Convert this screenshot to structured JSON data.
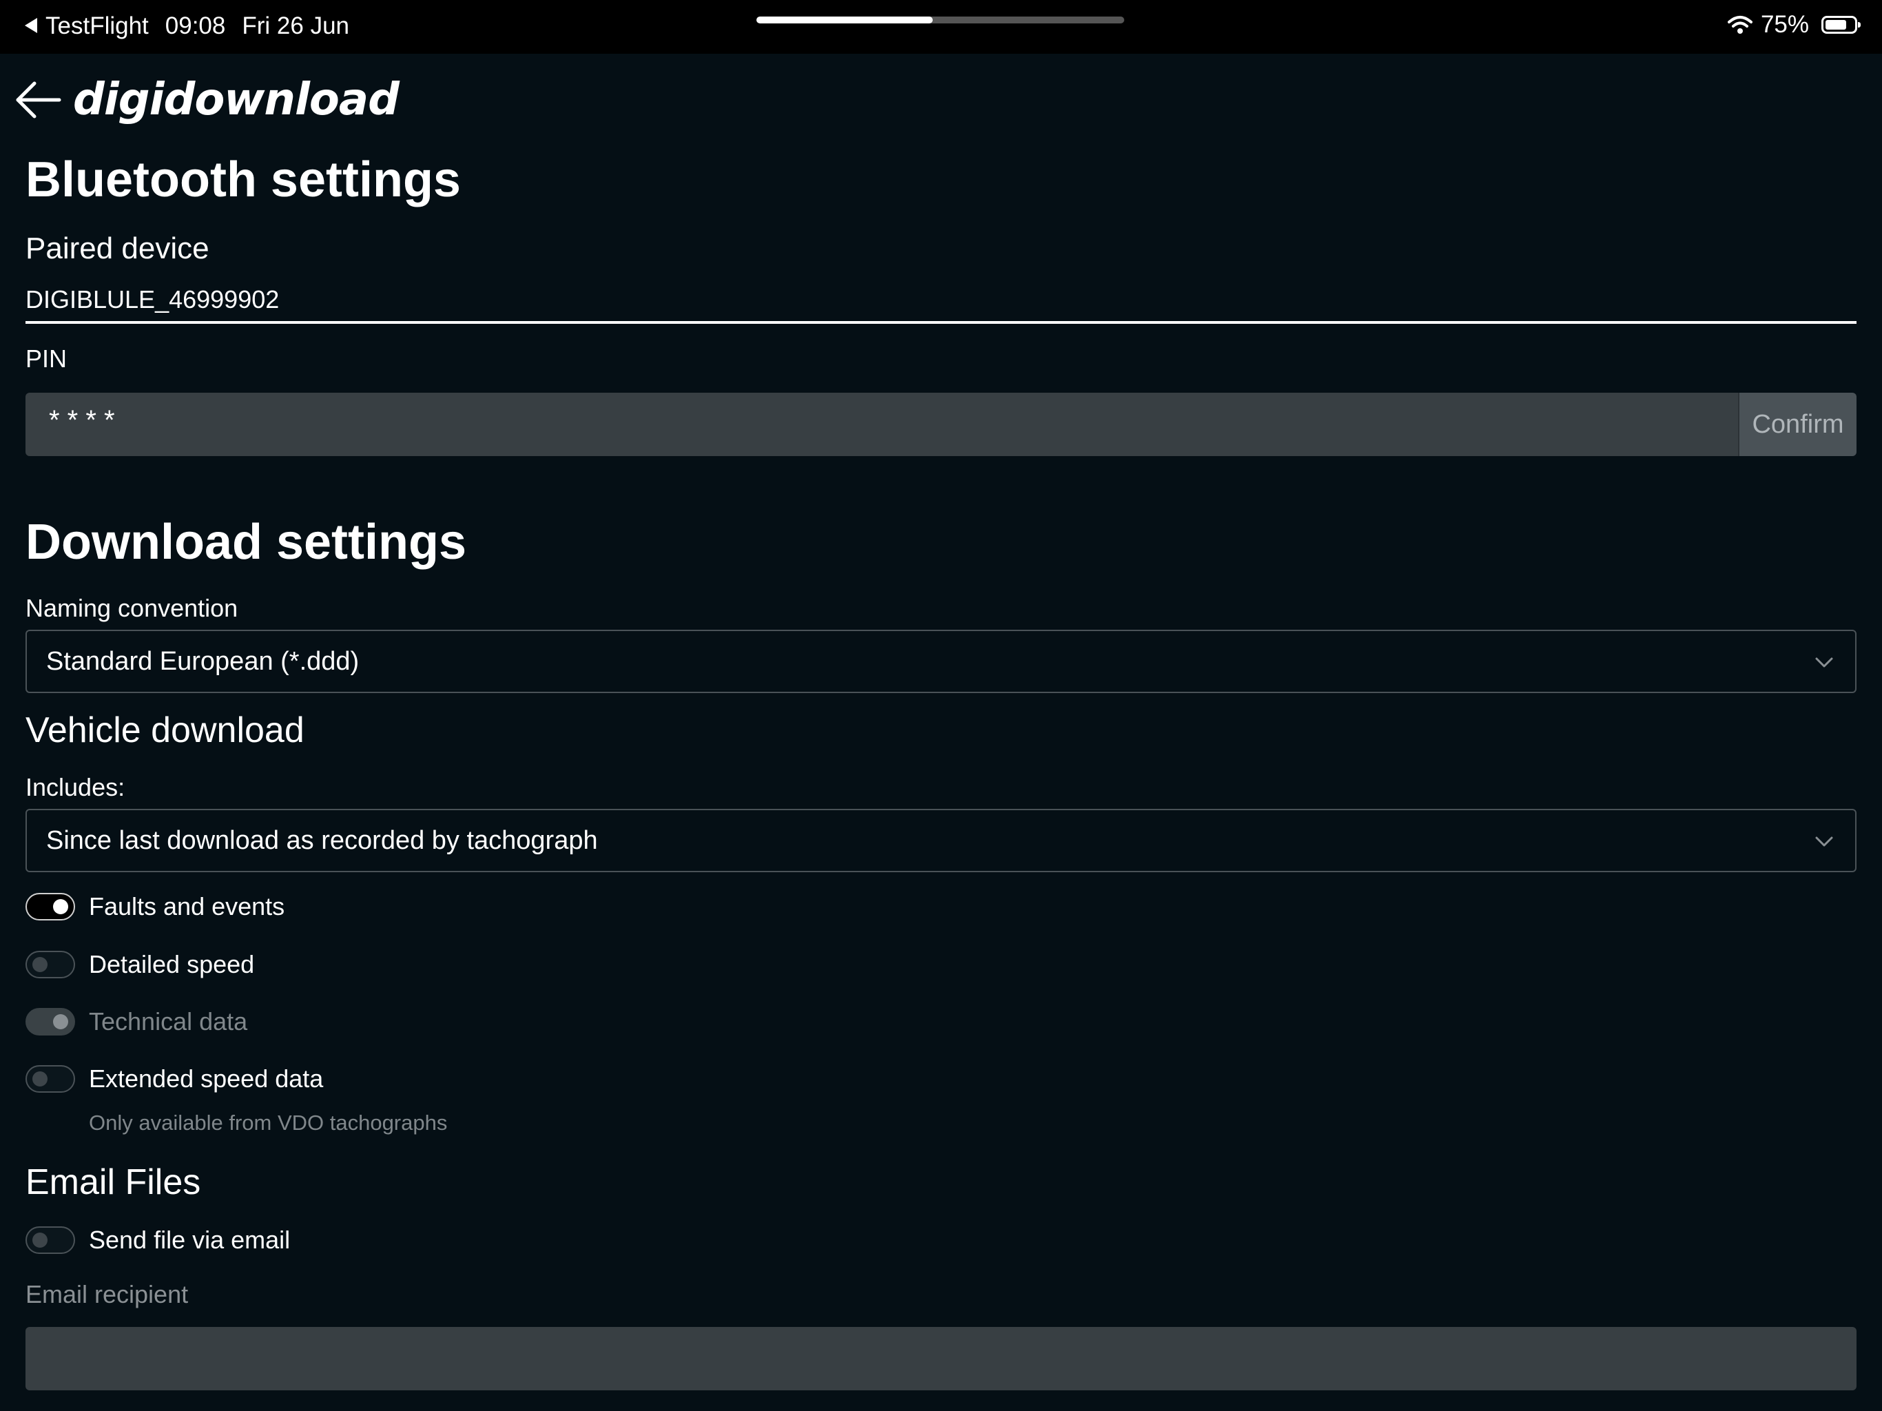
{
  "status_bar": {
    "back_app": "TestFlight",
    "time": "09:08",
    "date": "Fri 26 Jun",
    "battery": "75%",
    "battery_level": 0.75,
    "multitask_progress": 0.48
  },
  "header": {
    "back_icon": "arrow-left-icon",
    "logo": "digidownload"
  },
  "bluetooth": {
    "title": "Bluetooth settings",
    "paired_label": "Paired device",
    "paired_value": "DIGIBLULE_46999902",
    "pin_label": "PIN",
    "pin_value": "* * * *",
    "confirm_label": "Confirm"
  },
  "download": {
    "title": "Download settings",
    "naming_label": "Naming convention",
    "naming_value": "Standard European (*.ddd)"
  },
  "vehicle": {
    "title": "Vehicle download",
    "includes_label": "Includes:",
    "includes_value": "Since last download as recorded by tachograph",
    "toggles": [
      {
        "label": "Faults and events",
        "state": "on"
      },
      {
        "label": "Detailed speed",
        "state": "off"
      },
      {
        "label": "Technical data",
        "state": "disabled-on"
      },
      {
        "label": "Extended speed data",
        "state": "off"
      }
    ],
    "extended_hint": "Only available from VDO tachographs"
  },
  "email": {
    "title": "Email Files",
    "send_label": "Send file via email",
    "send_state": "off",
    "recipient_label": "Email recipient",
    "recipient_value": ""
  },
  "colors": {
    "background": "#050f15",
    "input_bg": "#383f43",
    "muted_text": "#80878b"
  }
}
